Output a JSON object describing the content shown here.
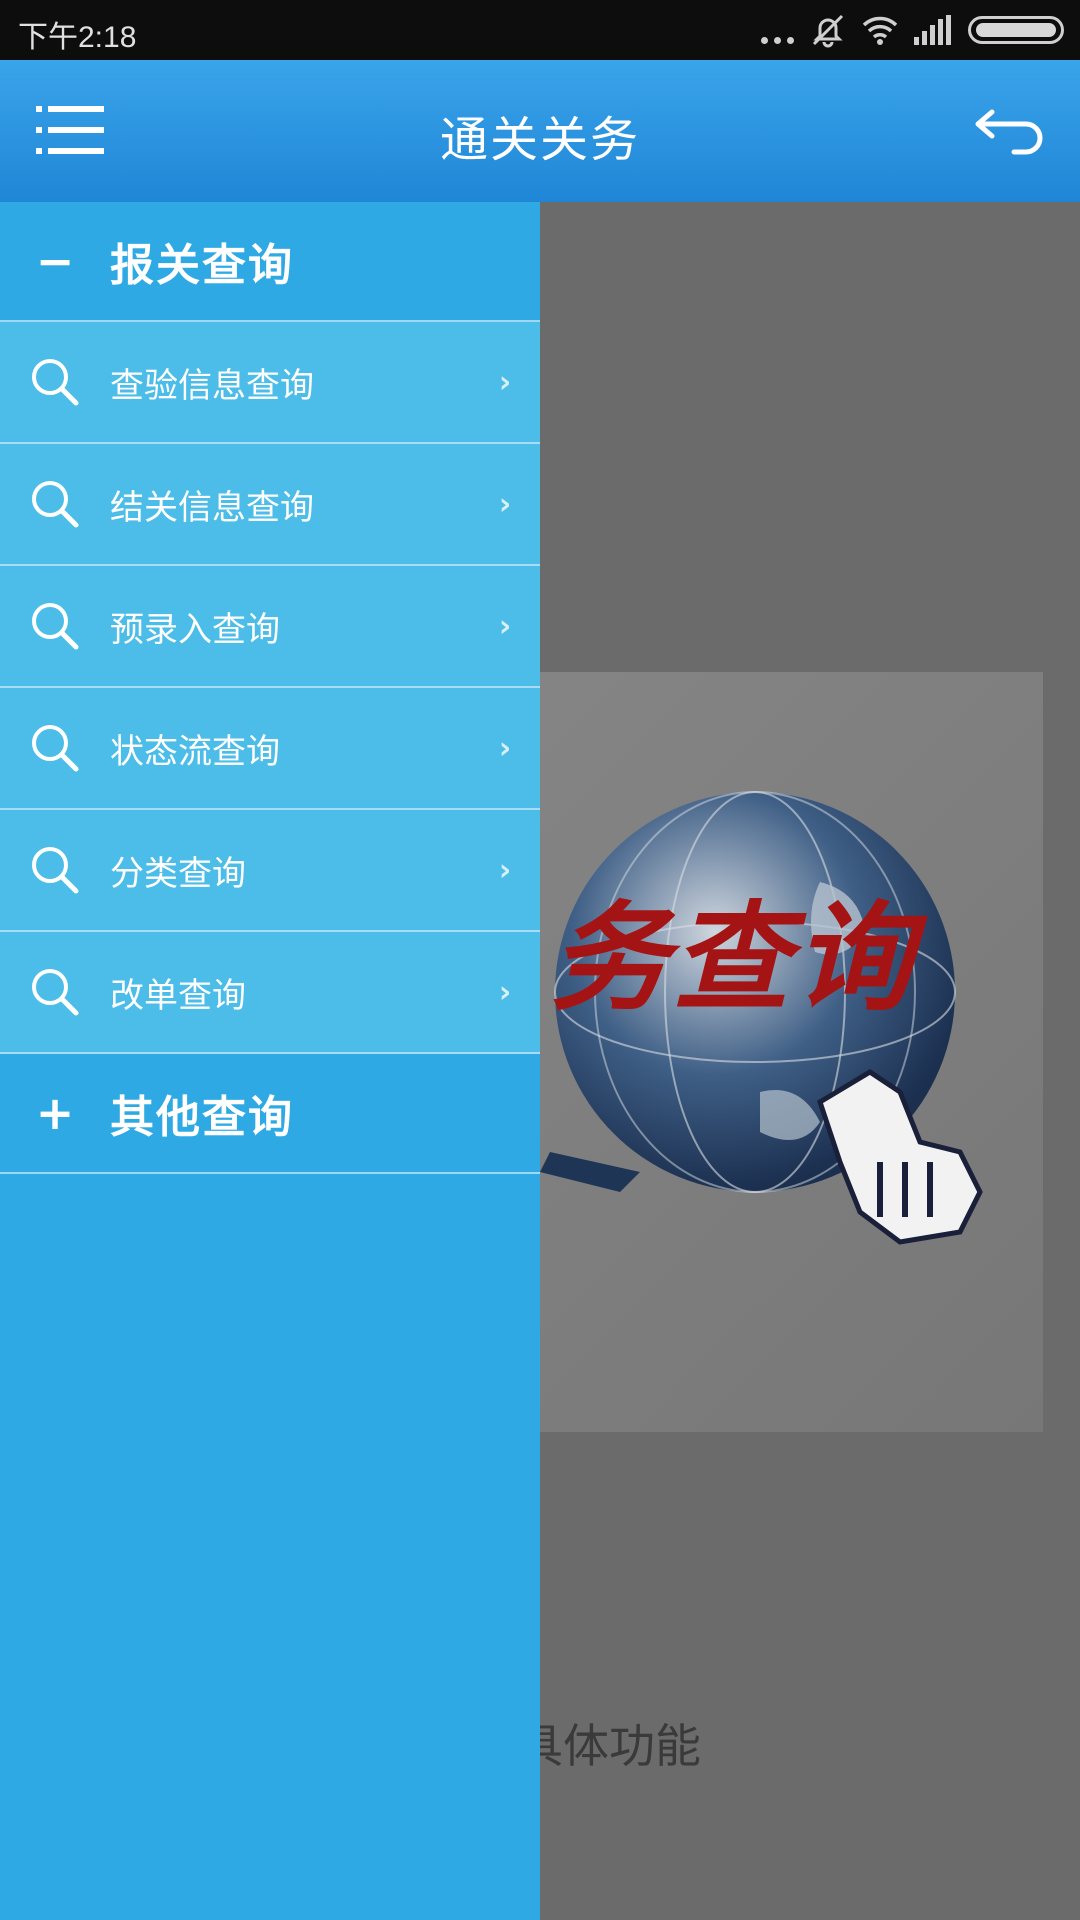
{
  "status_bar": {
    "time": "下午2:18",
    "icons": [
      "more-dots-icon",
      "silent-icon",
      "wifi-icon",
      "signal-icon",
      "battery-icon"
    ]
  },
  "app_bar": {
    "title": "通关关务",
    "left_icon": "menu-list-icon",
    "right_icon": "back-arrow-icon"
  },
  "drawer": {
    "groups": [
      {
        "sign": "−",
        "label": "报关查询",
        "expanded": true,
        "items": [
          {
            "label": "查验信息查询",
            "icon": "search-icon"
          },
          {
            "label": "结关信息查询",
            "icon": "search-icon"
          },
          {
            "label": "预录入查询",
            "icon": "search-icon"
          },
          {
            "label": "状态流查询",
            "icon": "search-icon"
          },
          {
            "label": "分类查询",
            "icon": "search-icon"
          },
          {
            "label": "改单查询",
            "icon": "search-icon"
          }
        ]
      },
      {
        "sign": "+",
        "label": "其他查询",
        "expanded": false,
        "items": []
      }
    ],
    "chevron": "›"
  },
  "main": {
    "banner_text": "务查询",
    "hint": "栏选择具体功能"
  },
  "colors": {
    "app_bar": "#2a94de",
    "drawer": "#2ea9e3",
    "drawer_item": "#4bbde8",
    "banner_text": "#a41414",
    "overlay": "#6b6b6b"
  }
}
